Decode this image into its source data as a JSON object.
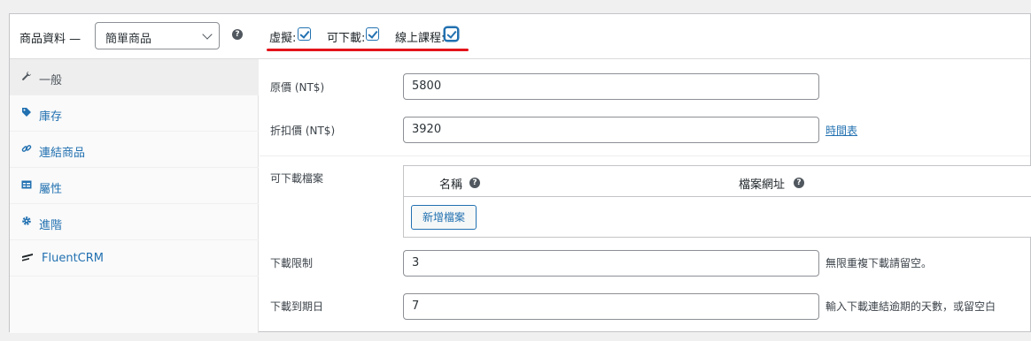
{
  "header": {
    "title": "商品資料 —",
    "product_type": "簡單商品",
    "help_icon": "question-circle-icon",
    "options": [
      {
        "label": "虛擬:",
        "checked": true
      },
      {
        "label": "可下載:",
        "checked": true
      },
      {
        "label": "線上課程:",
        "checked": true
      }
    ],
    "highlight_color": "#e3131a"
  },
  "sidebar": {
    "items": [
      {
        "label": "一般",
        "icon": "wrench-icon",
        "active": true
      },
      {
        "label": "庫存",
        "icon": "tag-icon",
        "active": false
      },
      {
        "label": "連結商品",
        "icon": "link-icon",
        "active": false
      },
      {
        "label": "屬性",
        "icon": "table-icon",
        "active": false
      },
      {
        "label": "進階",
        "icon": "gear-icon",
        "active": false
      },
      {
        "label": "FluentCRM",
        "icon": "fluentcrm-icon",
        "active": false
      }
    ]
  },
  "general": {
    "regular_price_label": "原價 (NT$)",
    "regular_price": "5800",
    "sale_price_label": "折扣價 (NT$)",
    "sale_price": "3920",
    "schedule_link": "時間表",
    "downloads_label": "可下載檔案",
    "col_name": "名稱",
    "col_url": "檔案網址",
    "add_file_button": "新增檔案",
    "download_limit_label": "下載限制",
    "download_limit": "3",
    "download_limit_desc": "無限重複下載請留空。",
    "download_expiry_label": "下載到期日",
    "download_expiry": "7",
    "download_expiry_desc": "輸入下載連結逾期的天數，或留空白"
  },
  "accent_color": "#2271b1"
}
